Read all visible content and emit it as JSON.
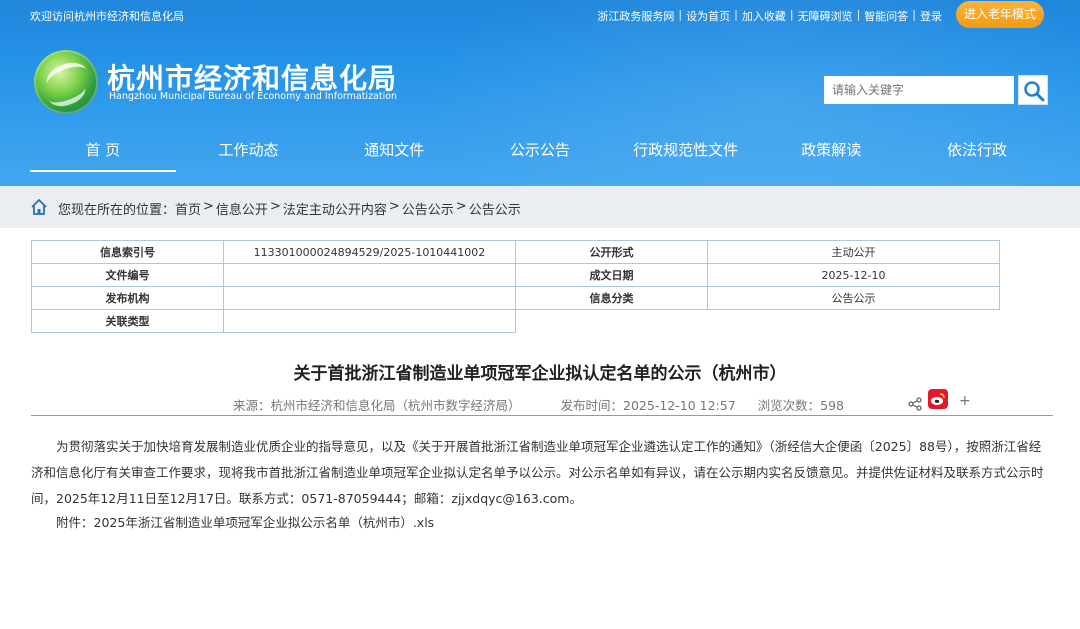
{
  "topbar": {
    "welcome": "欢迎访问杭州市经济和信息化局",
    "links": [
      "浙江政务服务网",
      "设为首页",
      "加入收藏",
      "无障碍浏览",
      "智能问答",
      "登录"
    ],
    "separator": "|",
    "elder_mode": "进入老年模式"
  },
  "logo": {
    "title": "杭州市经济和信息化局",
    "subtitle": "Hangzhou Municipal Bureau of Economy and Informatization"
  },
  "search": {
    "placeholder": "请输入关键字"
  },
  "nav": {
    "items": [
      {
        "label": "首 页"
      },
      {
        "label": "工作动态"
      },
      {
        "label": "通知文件"
      },
      {
        "label": "公示公告"
      },
      {
        "label": "行政规范性文件"
      },
      {
        "label": "政策解读"
      },
      {
        "label": "依法行政"
      }
    ]
  },
  "breadcrumb": {
    "label": "您现在所在的位置：",
    "items": [
      "首页",
      "信息公开",
      "法定主动公开内容",
      "公告公示",
      "公告公示"
    ],
    "separator": ">"
  },
  "info": {
    "index_label": "信息索引号",
    "index_value": "113301000024894529/2025-1010441002",
    "form_label": "公开形式",
    "form_value": "主动公开",
    "docno_label": "文件编号",
    "docno_value": "",
    "date_label": "成文日期",
    "date_value": "2025-12-10",
    "org_label": "发布机构",
    "org_value": "",
    "category_label": "信息分类",
    "category_value": "公告公示",
    "related_label": "关联类型",
    "related_value": ""
  },
  "article": {
    "title": "关于首批浙江省制造业单项冠军企业拟认定名单的公示（杭州市）",
    "source": "来源：杭州市经济和信息化局（杭州市数字经济局）",
    "publish_time": "发布时间：2025-12-10 12:57",
    "views": "浏览次数：598",
    "plus": "+",
    "body": "为贯彻落实关于加快培育发展制造业优质企业的指导意见，以及《关于开展首批浙江省制造业单项冠军企业遴选认定工作的通知》（浙经信大企便函〔2025〕88号），按照浙江省经济和信息化厅有关审查工作要求，现将我市首批浙江省制造业单项冠军企业拟认定名单予以公示。对公示名单如有异议，请在公示期内实名反馈意见。并提供佐证材料及联系方式公示时间，2025年12月11日至12月17日。联系方式：0571-87059444；邮箱：zjjxdqyc@163.com。",
    "attachment_label": "附件：",
    "attachment_file": "2025年浙江省制造业单项冠军企业拟公示名单（杭州市）.xls"
  },
  "colors": {
    "header_blue": "#2693e8",
    "elder_orange": "#f49a12",
    "crumb_bg": "#eaeef2",
    "table_border": "#a9c8e2",
    "weibo_red": "#e6162d"
  }
}
